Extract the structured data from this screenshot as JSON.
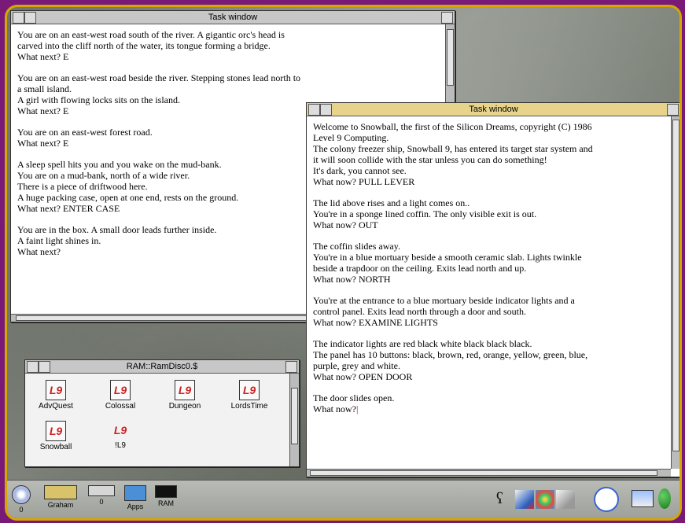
{
  "colors": {
    "desktop": "#7a8077",
    "frame": "#d6a600",
    "active_title": "#e7d48a",
    "caret": "#d00000"
  },
  "window1": {
    "title": "Task window",
    "paragraphs": [
      [
        "You are on an east-west road south of the river. A gigantic orc's head is",
        "carved into the cliff north of the water, its tongue forming a bridge.",
        "What next? E"
      ],
      [
        "You are on an east-west road beside the river. Stepping stones lead north to",
        "a small island.",
        "A girl with flowing locks sits on the island.",
        "What next? E"
      ],
      [
        "You are on an east-west forest road.",
        "What next? E"
      ],
      [
        "A sleep spell hits you and you wake on the mud-bank.",
        "You are on a mud-bank, north of a wide river.",
        "There is a piece of driftwood here.",
        "A huge packing case, open at one end, rests on the ground.",
        "What next? ENTER CASE"
      ],
      [
        "You are in the box. A small door leads further inside.",
        "A faint light shines in.",
        "What next?"
      ]
    ]
  },
  "window2": {
    "title": "Task window",
    "paragraphs": [
      [
        "Welcome to Snowball, the first of the Silicon Dreams, copyright (C) 1986",
        "Level 9 Computing.",
        "The colony freezer ship, Snowball 9, has entered its target star system and",
        "it will soon collide with the star unless you can do something!",
        "It's dark, you cannot see.",
        "What now? PULL LEVER"
      ],
      [
        "The lid above rises and a light comes on..",
        "You're in a sponge lined coffin. The only visible exit is out.",
        "What now? OUT"
      ],
      [
        "The coffin slides away.",
        "You're in a blue mortuary beside a smooth ceramic slab. Lights twinkle",
        "beside a trapdoor on the ceiling. Exits lead north and up.",
        "What now? NORTH"
      ],
      [
        "You're at the entrance to a blue mortuary beside indicator lights and a",
        "control panel. Exits lead north through a door and south.",
        "What now? EXAMINE LIGHTS"
      ],
      [
        "The indicator lights are red black white black black black.",
        "The panel has 10 buttons: black, brown, red, orange, yellow, green, blue,",
        "purple, grey and white.",
        "What now? OPEN DOOR"
      ],
      [
        "The door slides open.",
        "What now?"
      ]
    ]
  },
  "filer": {
    "title": "RAM::RamDisc0.$",
    "items": [
      "AdvQuest",
      "Colossal",
      "Dungeon",
      "LordsTime",
      "Snowball",
      "!L9"
    ]
  },
  "iconbar": {
    "left": [
      {
        "icon": "disc-icon",
        "label": "0"
      },
      {
        "icon": "hard-disc-icon",
        "label": "Graham"
      },
      {
        "icon": "floppy-drive-icon",
        "label": "0"
      },
      {
        "icon": "apps-icon",
        "label": "Apps"
      },
      {
        "icon": "ram-disc-icon",
        "label": "RAM"
      }
    ],
    "right_icons": [
      "paint-icon",
      "draw-icon",
      "palette-icon",
      "edit-icon",
      "clock-icon",
      "display-icon",
      "task-manager-icon"
    ]
  }
}
